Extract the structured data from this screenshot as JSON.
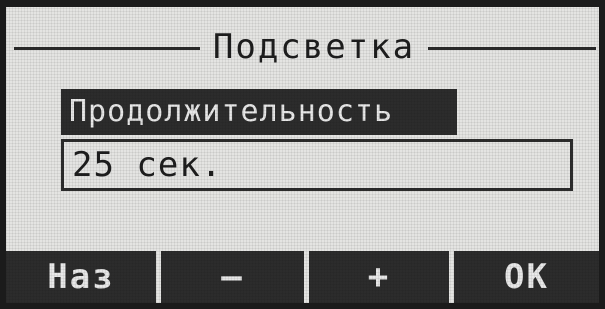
{
  "screen": {
    "title": "Подсветка"
  },
  "setting": {
    "label": "Продолжительность",
    "value": "25 сек."
  },
  "softkeys": {
    "back": "Наз",
    "minus": "–",
    "plus": "+",
    "ok": "ОК"
  },
  "colors": {
    "lcd_background": "#e4e4e2",
    "lcd_ink": "#2c2c2c"
  }
}
